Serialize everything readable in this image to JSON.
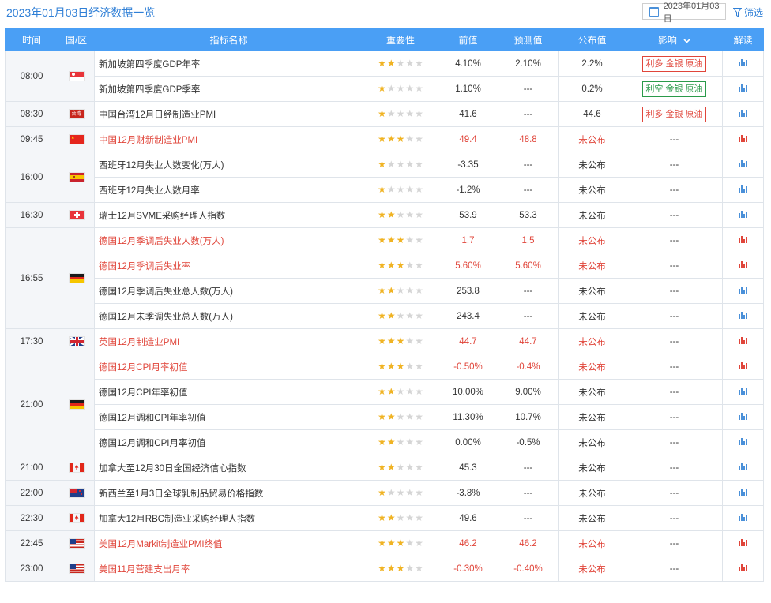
{
  "header": {
    "title": "2023年01月03日经济数据一览",
    "date": "2023年01月03日",
    "filter_label": "筛选"
  },
  "columns": [
    "时间",
    "国/区",
    "指标名称",
    "重要性",
    "前值",
    "预测值",
    "公布值",
    "影响",
    "解读"
  ],
  "colors": {
    "accent": "#4a9ff5",
    "highlight": "#e0453a",
    "bullish": "#e0453a",
    "bearish": "#2a9a4a",
    "star": "#f0b323"
  },
  "rows": [
    {
      "time": "08:00",
      "country": "singapore",
      "name": "新加坡第四季度GDP年率",
      "stars": 2,
      "prev": "4.10%",
      "forecast": "2.10%",
      "actual": "2.2%",
      "impact": "利多 金银 原油",
      "impact_type": "bull",
      "hl": false
    },
    {
      "time": "",
      "country": "",
      "name": "新加坡第四季度GDP季率",
      "stars": 1,
      "prev": "1.10%",
      "forecast": "---",
      "actual": "0.2%",
      "impact": "利空 金银 原油",
      "impact_type": "bear",
      "hl": false
    },
    {
      "time": "08:30",
      "country": "taiwan",
      "name": "中国台湾12月日经制造业PMI",
      "stars": 1,
      "prev": "41.6",
      "forecast": "---",
      "actual": "44.6",
      "impact": "利多 金银 原油",
      "impact_type": "bull",
      "hl": false
    },
    {
      "time": "09:45",
      "country": "china",
      "name": "中国12月财新制造业PMI",
      "stars": 3,
      "prev": "49.4",
      "forecast": "48.8",
      "actual": "未公布",
      "impact": "---",
      "impact_type": "",
      "hl": true
    },
    {
      "time": "16:00",
      "country": "spain",
      "name": "西班牙12月失业人数变化(万人)",
      "stars": 1,
      "prev": "-3.35",
      "forecast": "---",
      "actual": "未公布",
      "impact": "---",
      "impact_type": "",
      "hl": false
    },
    {
      "time": "",
      "country": "",
      "name": "西班牙12月失业人数月率",
      "stars": 1,
      "prev": "-1.2%",
      "forecast": "---",
      "actual": "未公布",
      "impact": "---",
      "impact_type": "",
      "hl": false
    },
    {
      "time": "16:30",
      "country": "switzerland",
      "name": "瑞士12月SVME采购经理人指数",
      "stars": 2,
      "prev": "53.9",
      "forecast": "53.3",
      "actual": "未公布",
      "impact": "---",
      "impact_type": "",
      "hl": false
    },
    {
      "time": "16:55",
      "country": "germany",
      "name": "德国12月季调后失业人数(万人)",
      "stars": 3,
      "prev": "1.7",
      "forecast": "1.5",
      "actual": "未公布",
      "impact": "---",
      "impact_type": "",
      "hl": true
    },
    {
      "time": "",
      "country": "",
      "name": "德国12月季调后失业率",
      "stars": 3,
      "prev": "5.60%",
      "forecast": "5.60%",
      "actual": "未公布",
      "impact": "---",
      "impact_type": "",
      "hl": true
    },
    {
      "time": "",
      "country": "",
      "name": "德国12月季调后失业总人数(万人)",
      "stars": 2,
      "prev": "253.8",
      "forecast": "---",
      "actual": "未公布",
      "impact": "---",
      "impact_type": "",
      "hl": false
    },
    {
      "time": "",
      "country": "",
      "name": "德国12月未季调失业总人数(万人)",
      "stars": 2,
      "prev": "243.4",
      "forecast": "---",
      "actual": "未公布",
      "impact": "---",
      "impact_type": "",
      "hl": false
    },
    {
      "time": "17:30",
      "country": "uk",
      "name": "英国12月制造业PMI",
      "stars": 3,
      "prev": "44.7",
      "forecast": "44.7",
      "actual": "未公布",
      "impact": "---",
      "impact_type": "",
      "hl": true
    },
    {
      "time": "21:00",
      "country": "germany",
      "name": "德国12月CPI月率初值",
      "stars": 3,
      "prev": "-0.50%",
      "forecast": "-0.4%",
      "actual": "未公布",
      "impact": "---",
      "impact_type": "",
      "hl": true
    },
    {
      "time": "",
      "country": "",
      "name": "德国12月CPI年率初值",
      "stars": 2,
      "prev": "10.00%",
      "forecast": "9.00%",
      "actual": "未公布",
      "impact": "---",
      "impact_type": "",
      "hl": false
    },
    {
      "time": "",
      "country": "",
      "name": "德国12月调和CPI年率初值",
      "stars": 2,
      "prev": "11.30%",
      "forecast": "10.7%",
      "actual": "未公布",
      "impact": "---",
      "impact_type": "",
      "hl": false
    },
    {
      "time": "",
      "country": "",
      "name": "德国12月调和CPI月率初值",
      "stars": 2,
      "prev": "0.00%",
      "forecast": "-0.5%",
      "actual": "未公布",
      "impact": "---",
      "impact_type": "",
      "hl": false
    },
    {
      "time": "21:00",
      "country": "canada",
      "name": "加拿大至12月30日全国经济信心指数",
      "stars": 2,
      "prev": "45.3",
      "forecast": "---",
      "actual": "未公布",
      "impact": "---",
      "impact_type": "",
      "hl": false
    },
    {
      "time": "22:00",
      "country": "newzealand",
      "name": "新西兰至1月3日全球乳制品贸易价格指数",
      "stars": 1,
      "prev": "-3.8%",
      "forecast": "---",
      "actual": "未公布",
      "impact": "---",
      "impact_type": "",
      "hl": false
    },
    {
      "time": "22:30",
      "country": "canada",
      "name": "加拿大12月RBC制造业采购经理人指数",
      "stars": 2,
      "prev": "49.6",
      "forecast": "---",
      "actual": "未公布",
      "impact": "---",
      "impact_type": "",
      "hl": false
    },
    {
      "time": "22:45",
      "country": "usa",
      "name": "美国12月Markit制造业PMI终值",
      "stars": 3,
      "prev": "46.2",
      "forecast": "46.2",
      "actual": "未公布",
      "impact": "---",
      "impact_type": "",
      "hl": true
    },
    {
      "time": "23:00",
      "country": "usa",
      "name": "美国11月营建支出月率",
      "stars": 3,
      "prev": "-0.30%",
      "forecast": "-0.40%",
      "actual": "未公布",
      "impact": "---",
      "impact_type": "",
      "hl": true
    }
  ]
}
